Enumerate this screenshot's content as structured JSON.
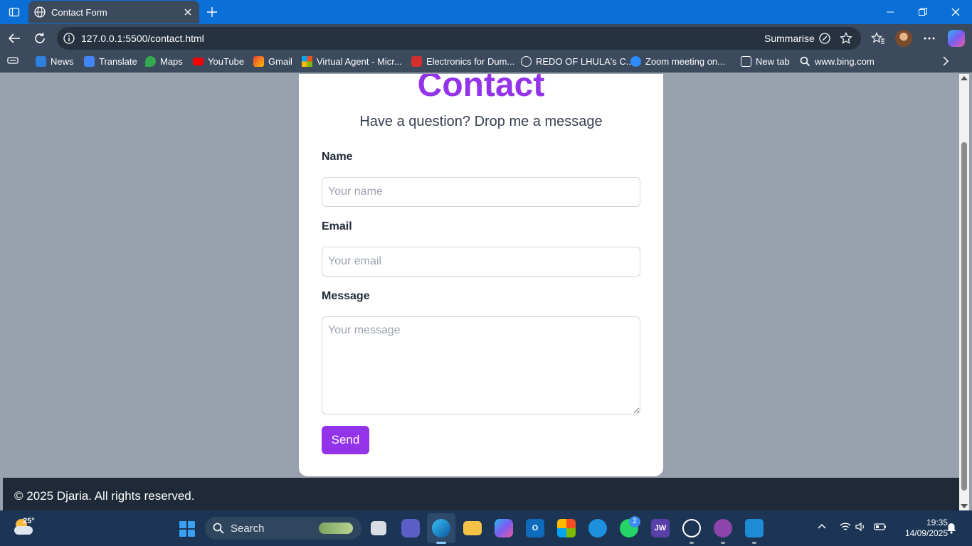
{
  "browser": {
    "tab_title": "Contact Form",
    "url": "127.0.0.1:5500/contact.html",
    "summarise_label": "Summarise"
  },
  "bookmarks": [
    {
      "label": "News",
      "icon": "news-icon",
      "color": "#2f7fdc"
    },
    {
      "label": "Translate",
      "icon": "translate-icon",
      "color": "#4285f4"
    },
    {
      "label": "Maps",
      "icon": "maps-icon",
      "color": "#34a853"
    },
    {
      "label": "YouTube",
      "icon": "youtube-icon",
      "color": "#ff0000"
    },
    {
      "label": "Gmail",
      "icon": "gmail-icon",
      "color": "#ea4335"
    },
    {
      "label": "Virtual Agent - Micr...",
      "icon": "microsoft-icon",
      "color": "#f25022"
    },
    {
      "label": "Electronics for Dum...",
      "icon": "pdf-icon",
      "color": "#d32f2f"
    },
    {
      "label": "REDO OF LHULA's C...",
      "icon": "globe-icon",
      "color": "#ffffff"
    },
    {
      "label": "Zoom meeting on...",
      "icon": "zoom-icon",
      "color": "#2d8cff"
    },
    {
      "label": "New tab",
      "icon": "new-tab-icon",
      "color": "#ffffff"
    },
    {
      "label": "www.bing.com",
      "icon": "search-icon",
      "color": "#ffffff"
    }
  ],
  "page": {
    "heading": "Contact",
    "subheading": "Have a question? Drop me a message",
    "name_label": "Name",
    "name_placeholder": "Your name",
    "email_label": "Email",
    "email_placeholder": "Your email",
    "message_label": "Message",
    "message_placeholder": "Your message",
    "send_label": "Send",
    "footer_text": "© 2025 Djaria. All rights reserved.",
    "accent_color": "#9333ea"
  },
  "taskbar": {
    "temperature": "25°",
    "search_label": "Search",
    "whatsapp_badge": "2",
    "jw_label": "JW",
    "time": "19:35",
    "date": "14/09/2025"
  }
}
